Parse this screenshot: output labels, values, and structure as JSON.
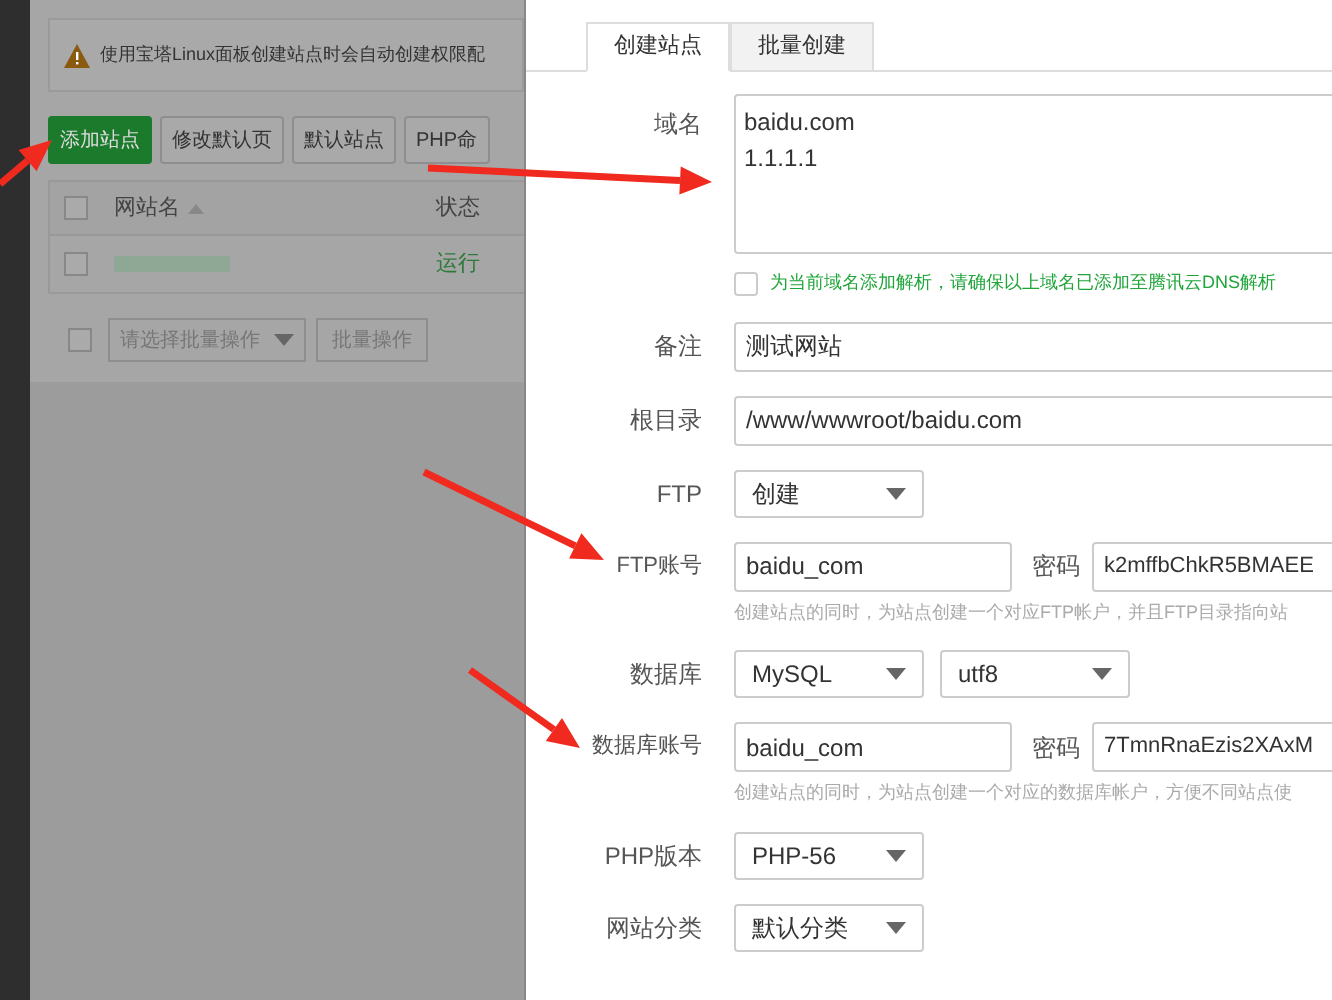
{
  "background": {
    "notice": "使用宝塔Linux面板创建站点时会自动创建权限配",
    "buttons": [
      {
        "label": "添加站点",
        "primary": true
      },
      {
        "label": "修改默认页",
        "primary": false
      },
      {
        "label": "默认站点",
        "primary": false
      },
      {
        "label": "PHP命",
        "primary": false
      }
    ],
    "table": {
      "select_all_checked": false,
      "columns": [
        "网站名",
        "状态"
      ],
      "rows": [
        {
          "checked": false,
          "status": "运行"
        }
      ]
    },
    "batch_checked": false,
    "batch_select": {
      "placeholder": "请选择批量操作"
    },
    "batch_button": "批量操作"
  },
  "dialog": {
    "tabs": [
      {
        "label": "创建站点",
        "selected": true
      },
      {
        "label": "批量创建",
        "selected": false
      }
    ],
    "fields": [
      {
        "kind": "textarea",
        "label": "域名",
        "lines": [
          "baidu.com",
          "1.1.1.1"
        ]
      },
      {
        "kind": "checkbox",
        "label": "为当前域名添加解析，请确保以上域名已添加至腾讯云DNS解析",
        "checked": false
      },
      {
        "kind": "input",
        "label": "备注",
        "value": "测试网站"
      },
      {
        "kind": "input",
        "label": "根目录",
        "value": "/www/wwwroot/baidu.com"
      },
      {
        "kind": "select",
        "label": "FTP",
        "values": [
          "创建"
        ]
      },
      {
        "kind": "account",
        "label": "FTP账号",
        "value": "baidu_com",
        "password_label": "密码",
        "password": "k2mffbChkR5BMAEE",
        "hint": "创建站点的同时，为站点创建一个对应FTP帐户，并且FTP目录指向站"
      },
      {
        "kind": "select",
        "label": "数据库",
        "values": [
          "MySQL",
          "utf8"
        ]
      },
      {
        "kind": "account",
        "label": "数据库账号",
        "value": "baidu_com",
        "password_label": "密码",
        "password": "7TmnRnaEzis2XAxM",
        "hint": "创建站点的同时，为站点创建一个对应的数据库帐户，方便不同站点使"
      },
      {
        "kind": "select",
        "label": "PHP版本",
        "values": [
          "PHP-56"
        ]
      },
      {
        "kind": "select",
        "label": "网站分类",
        "values": [
          "默认分类"
        ]
      }
    ]
  }
}
